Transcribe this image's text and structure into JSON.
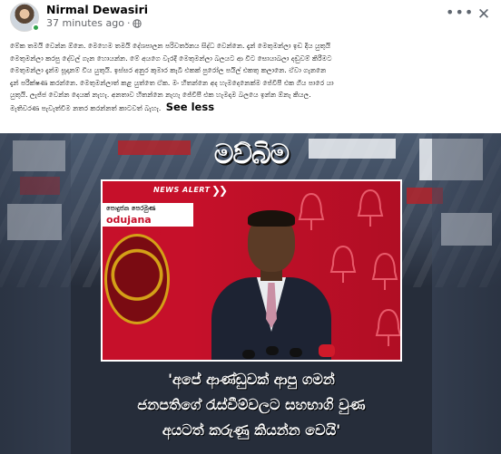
{
  "post": {
    "author": "Nirmal Dewasiri",
    "time": "37 minutes ago",
    "separator": "·",
    "privacy_icon": "globe-icon",
    "more_icon": "more-options-icon",
    "close_icon": "close-icon"
  },
  "caption": {
    "lines": [
      "මේක තමයි වෙන්න ඕනෙ. මෙහෙම තමයි දේශපාලන පරිවර්තනය සිද්ධ වෙන්නෙ. දැන් මෙතුමන්ලා ඉඩ දිය යුතුයි",
      "මෙතුමන්ලා කරපු දේවල් ගැන හොයන්න. මේ අයගෙ වැරදි මෙතුමන්ලා බලයට ආ විට සොයාබලා දඬුවම් කිරීමට",
      "මෙතුමන්ලා දැන්ම සූදානම් විය යුතුයි. ඉස්සර අනුර කුමාර කැබී එකක් පුරෝල පයිල් එකතු කලානෙ. ඒවා ගැනනෙ",
      "දැන් පරීක්ෂණ කරන්නෙ. මෙතුමන්ලාත් කළ යුත්තෙ ඒක. මං හිතන්නෙ අද හැමදෙනෙක්ම ජේවීපී එක ගිය පාරෙ යා",
      "යුතුයි. ලැජ්ජ වෙන්න දෙයක් නැහැ. අනතාව හිතන්නෙ නැහැ ජේවීපී එක හැමදාම බලයෙ ඉන්න ඕනැ කියල.",
      "මැතිවරණ පැවැත්වීම නතර කරන්නත් කාටවත් බැහැ."
    ],
    "see_less": "See less"
  },
  "image": {
    "brand": "මව්බිම",
    "news_alert": "NEWS ALERT",
    "party_name_si": "පොදුජන පෙරමුණ",
    "party_name_en": "odujana Peramuna",
    "quote_lines": [
      "'අපේ ආණ්ඩුවක් ආපු ගමන්",
      "ජනපතිගේ රැස්වීම්වලට සහභාගි වුණ",
      "අයටත් කරුණු කියන්න වෙයි'"
    ]
  },
  "colors": {
    "accent_red": "#c6102a",
    "online_green": "#31a24c",
    "annotation_red": "#e02020"
  }
}
